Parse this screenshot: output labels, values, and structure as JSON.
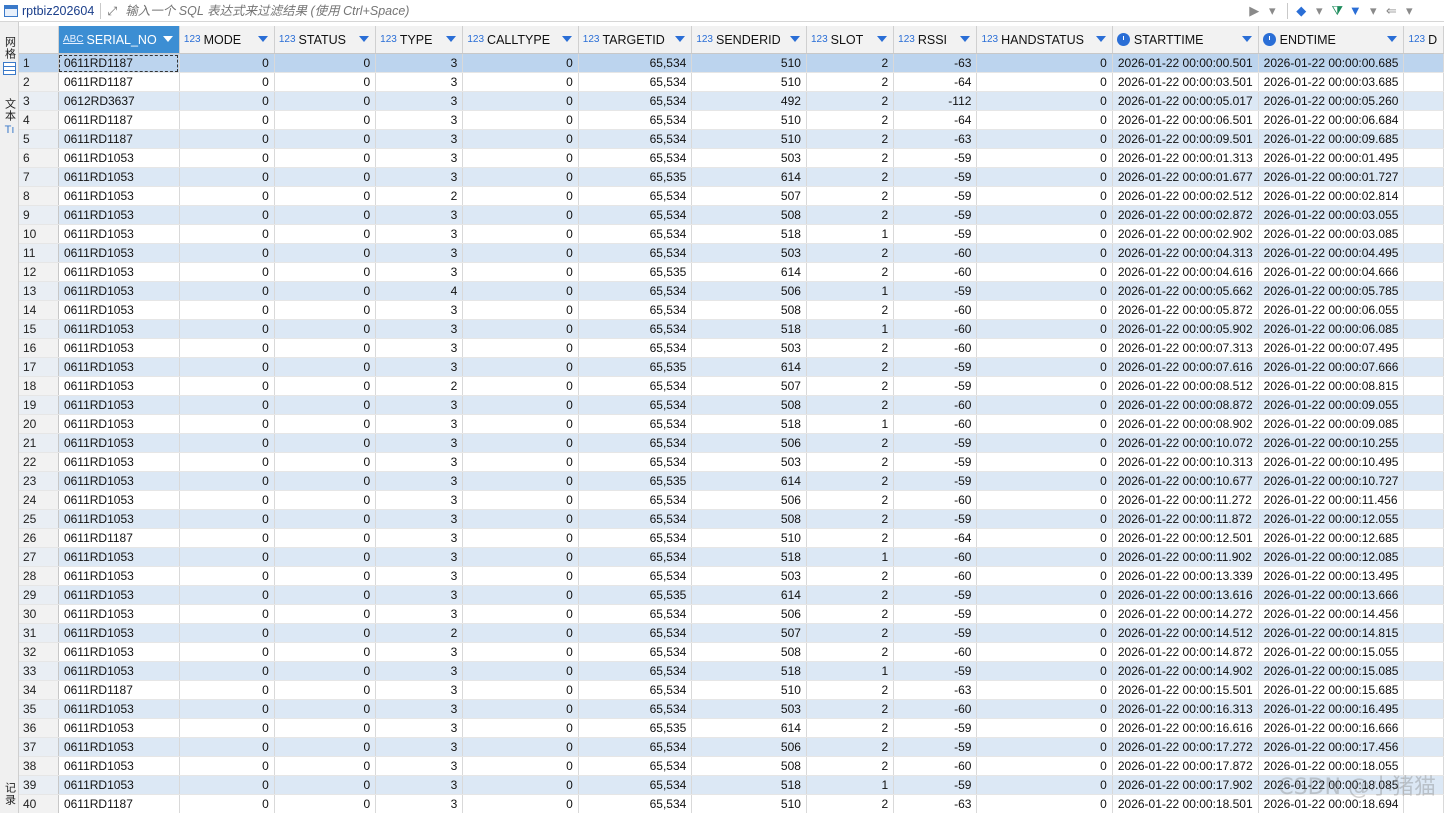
{
  "toolbar": {
    "tab_title": "rptbiz202604",
    "filter_placeholder": "输入一个 SQL 表达式来过滤结果 (使用 Ctrl+Space)",
    "run_glyph": "▶",
    "history_glyph": "▾",
    "eraser_glyph": "◆",
    "filter_glyph": "⧩",
    "filter_blue_glyph": "▼",
    "back_glyph": "⇐",
    "more_glyph": "▾"
  },
  "side_tabs": [
    {
      "label": "网格"
    },
    {
      "label": "文本"
    },
    {
      "label": "记录"
    }
  ],
  "columns": [
    {
      "type": "ABC",
      "name": "SERIAL_NO",
      "align": "txt",
      "width": 123
    },
    {
      "type": "123",
      "name": "MODE",
      "align": "num",
      "width": 98
    },
    {
      "type": "123",
      "name": "STATUS",
      "align": "num",
      "width": 104
    },
    {
      "type": "123",
      "name": "TYPE",
      "align": "num",
      "width": 90
    },
    {
      "type": "123",
      "name": "CALLTYPE",
      "align": "num",
      "width": 118
    },
    {
      "type": "123",
      "name": "TARGETID",
      "align": "num",
      "width": 116
    },
    {
      "type": "123",
      "name": "SENDERID",
      "align": "num",
      "width": 117
    },
    {
      "type": "123",
      "name": "SLOT",
      "align": "num",
      "width": 90
    },
    {
      "type": "123",
      "name": "RSSI",
      "align": "num",
      "width": 86
    },
    {
      "type": "123",
      "name": "HANDSTATUS",
      "align": "num",
      "width": 138
    },
    {
      "type": "clock",
      "name": "STARTTIME",
      "align": "txt",
      "width": 136
    },
    {
      "type": "clock",
      "name": "ENDTIME",
      "align": "txt",
      "width": 136
    },
    {
      "type": "123",
      "name": "D",
      "align": "num",
      "width": 40
    }
  ],
  "rows": [
    [
      "0611RD1187",
      "0",
      "0",
      "3",
      "0",
      "65,534",
      "510",
      "2",
      "-63",
      "0",
      "2026-01-22 00:00:00.501",
      "2026-01-22 00:00:00.685",
      ""
    ],
    [
      "0611RD1187",
      "0",
      "0",
      "3",
      "0",
      "65,534",
      "510",
      "2",
      "-64",
      "0",
      "2026-01-22 00:00:03.501",
      "2026-01-22 00:00:03.685",
      ""
    ],
    [
      "0612RD3637",
      "0",
      "0",
      "3",
      "0",
      "65,534",
      "492",
      "2",
      "-112",
      "0",
      "2026-01-22 00:00:05.017",
      "2026-01-22 00:00:05.260",
      ""
    ],
    [
      "0611RD1187",
      "0",
      "0",
      "3",
      "0",
      "65,534",
      "510",
      "2",
      "-64",
      "0",
      "2026-01-22 00:00:06.501",
      "2026-01-22 00:00:06.684",
      ""
    ],
    [
      "0611RD1187",
      "0",
      "0",
      "3",
      "0",
      "65,534",
      "510",
      "2",
      "-63",
      "0",
      "2026-01-22 00:00:09.501",
      "2026-01-22 00:00:09.685",
      ""
    ],
    [
      "0611RD1053",
      "0",
      "0",
      "3",
      "0",
      "65,534",
      "503",
      "2",
      "-59",
      "0",
      "2026-01-22 00:00:01.313",
      "2026-01-22 00:00:01.495",
      ""
    ],
    [
      "0611RD1053",
      "0",
      "0",
      "3",
      "0",
      "65,535",
      "614",
      "2",
      "-59",
      "0",
      "2026-01-22 00:00:01.677",
      "2026-01-22 00:00:01.727",
      ""
    ],
    [
      "0611RD1053",
      "0",
      "0",
      "2",
      "0",
      "65,534",
      "507",
      "2",
      "-59",
      "0",
      "2026-01-22 00:00:02.512",
      "2026-01-22 00:00:02.814",
      ""
    ],
    [
      "0611RD1053",
      "0",
      "0",
      "3",
      "0",
      "65,534",
      "508",
      "2",
      "-59",
      "0",
      "2026-01-22 00:00:02.872",
      "2026-01-22 00:00:03.055",
      ""
    ],
    [
      "0611RD1053",
      "0",
      "0",
      "3",
      "0",
      "65,534",
      "518",
      "1",
      "-59",
      "0",
      "2026-01-22 00:00:02.902",
      "2026-01-22 00:00:03.085",
      ""
    ],
    [
      "0611RD1053",
      "0",
      "0",
      "3",
      "0",
      "65,534",
      "503",
      "2",
      "-60",
      "0",
      "2026-01-22 00:00:04.313",
      "2026-01-22 00:00:04.495",
      ""
    ],
    [
      "0611RD1053",
      "0",
      "0",
      "3",
      "0",
      "65,535",
      "614",
      "2",
      "-60",
      "0",
      "2026-01-22 00:00:04.616",
      "2026-01-22 00:00:04.666",
      ""
    ],
    [
      "0611RD1053",
      "0",
      "0",
      "4",
      "0",
      "65,534",
      "506",
      "1",
      "-59",
      "0",
      "2026-01-22 00:00:05.662",
      "2026-01-22 00:00:05.785",
      ""
    ],
    [
      "0611RD1053",
      "0",
      "0",
      "3",
      "0",
      "65,534",
      "508",
      "2",
      "-60",
      "0",
      "2026-01-22 00:00:05.872",
      "2026-01-22 00:00:06.055",
      ""
    ],
    [
      "0611RD1053",
      "0",
      "0",
      "3",
      "0",
      "65,534",
      "518",
      "1",
      "-60",
      "0",
      "2026-01-22 00:00:05.902",
      "2026-01-22 00:00:06.085",
      ""
    ],
    [
      "0611RD1053",
      "0",
      "0",
      "3",
      "0",
      "65,534",
      "503",
      "2",
      "-60",
      "0",
      "2026-01-22 00:00:07.313",
      "2026-01-22 00:00:07.495",
      ""
    ],
    [
      "0611RD1053",
      "0",
      "0",
      "3",
      "0",
      "65,535",
      "614",
      "2",
      "-59",
      "0",
      "2026-01-22 00:00:07.616",
      "2026-01-22 00:00:07.666",
      ""
    ],
    [
      "0611RD1053",
      "0",
      "0",
      "2",
      "0",
      "65,534",
      "507",
      "2",
      "-59",
      "0",
      "2026-01-22 00:00:08.512",
      "2026-01-22 00:00:08.815",
      ""
    ],
    [
      "0611RD1053",
      "0",
      "0",
      "3",
      "0",
      "65,534",
      "508",
      "2",
      "-60",
      "0",
      "2026-01-22 00:00:08.872",
      "2026-01-22 00:00:09.055",
      ""
    ],
    [
      "0611RD1053",
      "0",
      "0",
      "3",
      "0",
      "65,534",
      "518",
      "1",
      "-60",
      "0",
      "2026-01-22 00:00:08.902",
      "2026-01-22 00:00:09.085",
      ""
    ],
    [
      "0611RD1053",
      "0",
      "0",
      "3",
      "0",
      "65,534",
      "506",
      "2",
      "-59",
      "0",
      "2026-01-22 00:00:10.072",
      "2026-01-22 00:00:10.255",
      ""
    ],
    [
      "0611RD1053",
      "0",
      "0",
      "3",
      "0",
      "65,534",
      "503",
      "2",
      "-59",
      "0",
      "2026-01-22 00:00:10.313",
      "2026-01-22 00:00:10.495",
      ""
    ],
    [
      "0611RD1053",
      "0",
      "0",
      "3",
      "0",
      "65,535",
      "614",
      "2",
      "-59",
      "0",
      "2026-01-22 00:00:10.677",
      "2026-01-22 00:00:10.727",
      ""
    ],
    [
      "0611RD1053",
      "0",
      "0",
      "3",
      "0",
      "65,534",
      "506",
      "2",
      "-60",
      "0",
      "2026-01-22 00:00:11.272",
      "2026-01-22 00:00:11.456",
      ""
    ],
    [
      "0611RD1053",
      "0",
      "0",
      "3",
      "0",
      "65,534",
      "508",
      "2",
      "-59",
      "0",
      "2026-01-22 00:00:11.872",
      "2026-01-22 00:00:12.055",
      ""
    ],
    [
      "0611RD1187",
      "0",
      "0",
      "3",
      "0",
      "65,534",
      "510",
      "2",
      "-64",
      "0",
      "2026-01-22 00:00:12.501",
      "2026-01-22 00:00:12.685",
      ""
    ],
    [
      "0611RD1053",
      "0",
      "0",
      "3",
      "0",
      "65,534",
      "518",
      "1",
      "-60",
      "0",
      "2026-01-22 00:00:11.902",
      "2026-01-22 00:00:12.085",
      ""
    ],
    [
      "0611RD1053",
      "0",
      "0",
      "3",
      "0",
      "65,534",
      "503",
      "2",
      "-60",
      "0",
      "2026-01-22 00:00:13.339",
      "2026-01-22 00:00:13.495",
      ""
    ],
    [
      "0611RD1053",
      "0",
      "0",
      "3",
      "0",
      "65,535",
      "614",
      "2",
      "-59",
      "0",
      "2026-01-22 00:00:13.616",
      "2026-01-22 00:00:13.666",
      ""
    ],
    [
      "0611RD1053",
      "0",
      "0",
      "3",
      "0",
      "65,534",
      "506",
      "2",
      "-59",
      "0",
      "2026-01-22 00:00:14.272",
      "2026-01-22 00:00:14.456",
      ""
    ],
    [
      "0611RD1053",
      "0",
      "0",
      "2",
      "0",
      "65,534",
      "507",
      "2",
      "-59",
      "0",
      "2026-01-22 00:00:14.512",
      "2026-01-22 00:00:14.815",
      ""
    ],
    [
      "0611RD1053",
      "0",
      "0",
      "3",
      "0",
      "65,534",
      "508",
      "2",
      "-60",
      "0",
      "2026-01-22 00:00:14.872",
      "2026-01-22 00:00:15.055",
      ""
    ],
    [
      "0611RD1053",
      "0",
      "0",
      "3",
      "0",
      "65,534",
      "518",
      "1",
      "-59",
      "0",
      "2026-01-22 00:00:14.902",
      "2026-01-22 00:00:15.085",
      ""
    ],
    [
      "0611RD1187",
      "0",
      "0",
      "3",
      "0",
      "65,534",
      "510",
      "2",
      "-63",
      "0",
      "2026-01-22 00:00:15.501",
      "2026-01-22 00:00:15.685",
      ""
    ],
    [
      "0611RD1053",
      "0",
      "0",
      "3",
      "0",
      "65,534",
      "503",
      "2",
      "-60",
      "0",
      "2026-01-22 00:00:16.313",
      "2026-01-22 00:00:16.495",
      ""
    ],
    [
      "0611RD1053",
      "0",
      "0",
      "3",
      "0",
      "65,535",
      "614",
      "2",
      "-59",
      "0",
      "2026-01-22 00:00:16.616",
      "2026-01-22 00:00:16.666",
      ""
    ],
    [
      "0611RD1053",
      "0",
      "0",
      "3",
      "0",
      "65,534",
      "506",
      "2",
      "-59",
      "0",
      "2026-01-22 00:00:17.272",
      "2026-01-22 00:00:17.456",
      ""
    ],
    [
      "0611RD1053",
      "0",
      "0",
      "3",
      "0",
      "65,534",
      "508",
      "2",
      "-60",
      "0",
      "2026-01-22 00:00:17.872",
      "2026-01-22 00:00:18.055",
      ""
    ],
    [
      "0611RD1053",
      "0",
      "0",
      "3",
      "0",
      "65,534",
      "518",
      "1",
      "-59",
      "0",
      "2026-01-22 00:00:17.902",
      "2026-01-22 00:00:18.085",
      ""
    ],
    [
      "0611RD1187",
      "0",
      "0",
      "3",
      "0",
      "65,534",
      "510",
      "2",
      "-63",
      "0",
      "2026-01-22 00:00:18.501",
      "2026-01-22 00:00:18.694",
      ""
    ]
  ],
  "selected_row": 1,
  "watermark": "CSDN @小猪猫"
}
